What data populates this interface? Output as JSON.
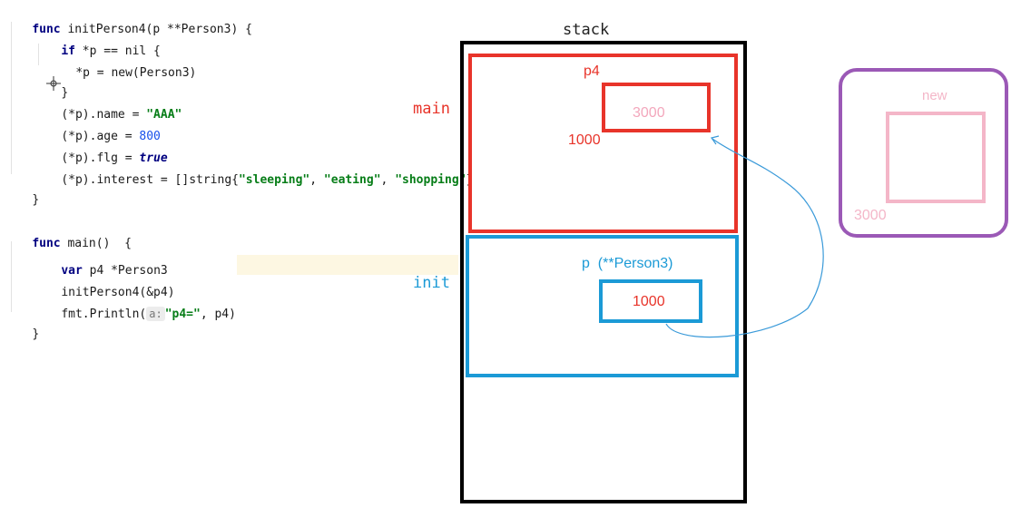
{
  "code": {
    "l1": {
      "kw": "func",
      "rest": " initPerson4(p **Person3) {"
    },
    "l2": {
      "kw": "if",
      "rest": " *p == nil {"
    },
    "l3": {
      "text": "*p = new(Person3)"
    },
    "l4": {
      "text": "}"
    },
    "l5": {
      "pre": "(*p).name = ",
      "str": "\"AAA\""
    },
    "l6": {
      "pre": "(*p).age = ",
      "num": "800"
    },
    "l7": {
      "pre": "(*p).flg = ",
      "kw": "true"
    },
    "l8": {
      "pre": "(*p).interest = []string{",
      "s1": "\"sleeping\"",
      "sep1": ", ",
      "s2": "\"eating\"",
      "sep2": ", ",
      "s3": "\"shopping\"",
      "post": "}"
    },
    "l9": {
      "text": "}"
    },
    "l10": {
      "kw": "func",
      "rest": " main()  {"
    },
    "l11": {
      "kw": "var",
      "rest": " p4 *Person3"
    },
    "l12": {
      "text": "initPerson4(&p4)"
    },
    "l13": {
      "pre": "fmt.Println(",
      "hint": "a:",
      "str": "\"p4=\"",
      "post": ", p4)"
    },
    "l14": {
      "text": "}"
    }
  },
  "diagram": {
    "stack_label": "stack",
    "main_label": "main",
    "init_label": "init",
    "p4_label": "p4",
    "p4_inner_value": "3000",
    "p4_address": "1000",
    "p_label": "p  (**Person3)",
    "p_value": "1000",
    "new_label": "new",
    "new_address": "3000"
  },
  "colors": {
    "main_frame": "#e8342a",
    "init_frame": "#1b9ad6",
    "new_frame": "#9b59b6",
    "new_inner": "#f4b6c8",
    "arrow": "#3a9ad9"
  }
}
